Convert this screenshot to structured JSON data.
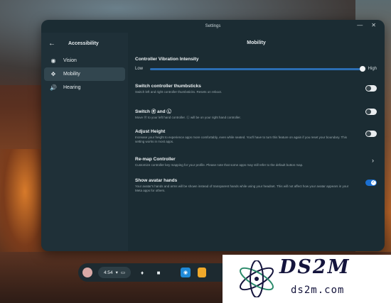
{
  "window": {
    "title": "Settings",
    "minimize_glyph": "—",
    "close_glyph": "✕"
  },
  "sidebar": {
    "back_icon": "arrow-left-icon",
    "title": "Accessibility",
    "items": [
      {
        "label": "Vision",
        "icon": "eye-icon",
        "active": false
      },
      {
        "label": "Mobility",
        "icon": "move-arrows-icon",
        "active": true
      },
      {
        "label": "Hearing",
        "icon": "speaker-icon",
        "active": false
      }
    ]
  },
  "main": {
    "title": "Mobility",
    "vibration": {
      "label": "Controller Vibration Intensity",
      "low": "Low",
      "high": "High",
      "value_fraction": 1.0
    },
    "settings": [
      {
        "title": "Switch controller thumbsticks",
        "desc": "Switch left and right controller thumbsticks. Resets on reboot.",
        "control": "toggle",
        "on": false
      },
      {
        "title": "Switch Ⓡ and Ⓛ",
        "desc": "Move Ⓡ to your left hand controller. Ⓛ will be on your right hand controller.",
        "control": "toggle",
        "on": false
      },
      {
        "title": "Adjust Height",
        "desc": "Increase your height to experience apps more comfortably, even while seated. You'll have to turn this feature on again if you reset your boundary. This setting works in most apps.",
        "control": "toggle",
        "on": false
      },
      {
        "title": "Re-map Controller",
        "desc": "Customize controller key mapping for your profile. Please note that some apps may still refer to the default button map.",
        "control": "chevron",
        "on": false
      },
      {
        "title": "Show avatar hands",
        "desc": "Your avatar's hands and arms will be shown instead of transparent hands while using your headset. This will not affect how your avatar appears in your Meta apps for others.",
        "control": "toggle",
        "on": true
      }
    ]
  },
  "taskbar": {
    "time": "4:54",
    "icons": [
      "avatar",
      "wifi-icon",
      "battery-icon",
      "bell-icon",
      "chat-icon",
      "app-icon-blue",
      "app-icon-orange"
    ]
  },
  "watermark": {
    "title": "DS2M",
    "subtitle": "ds2m.com"
  },
  "colors": {
    "accent": "#1b6fd0",
    "panel": "#1b2c33",
    "sidebar": "#1f3038"
  }
}
